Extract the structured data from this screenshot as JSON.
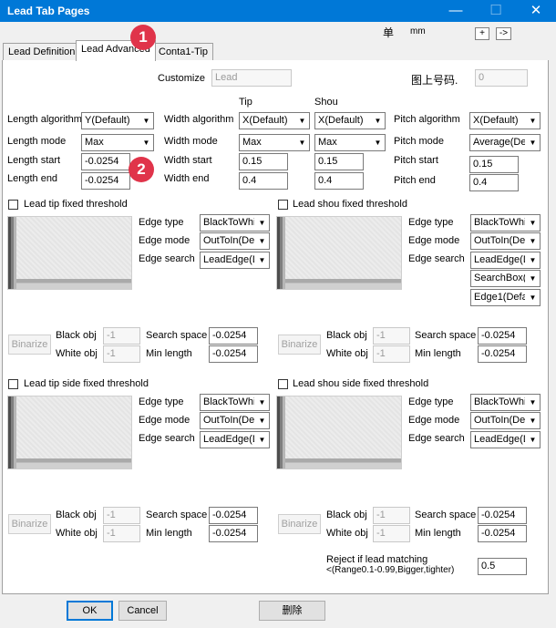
{
  "window": {
    "title": "Lead Tab Pages",
    "unit_label": "单",
    "unit_value": "mm",
    "plus_label": "+",
    "arrow_label": "->"
  },
  "tabs": [
    "Lead Definition",
    "Lead Advanced",
    "Conta1-Tip"
  ],
  "badges": [
    "1",
    "2"
  ],
  "customize": {
    "label": "Customize",
    "value": "Lead",
    "id_label": "图上号码.",
    "id_value": "0"
  },
  "columns": {
    "tip": "Tip",
    "shou": "Shou"
  },
  "algorithms": {
    "length_algorithm_label": "Length algorithm",
    "length_algorithm": "Y(Default)",
    "length_mode_label": "Length mode",
    "length_mode": "Max",
    "length_start_label": "Length start",
    "length_start": "-0.0254",
    "length_end_label": "Length end",
    "length_end": "-0.0254",
    "width_algorithm_label": "Width algorithm",
    "width_algorithm_tip": "X(Default)",
    "width_algorithm_shou": "X(Default)",
    "width_mode_label": "Width mode",
    "width_mode_tip": "Max",
    "width_mode_shou": "Max",
    "width_start_label": "Width start",
    "width_start_tip": "0.15",
    "width_start_shou": "0.15",
    "width_end_label": "Width end",
    "width_end_tip": "0.4",
    "width_end_shou": "0.4",
    "pitch_algorithm_label": "Pitch algorithm",
    "pitch_algorithm": "X(Default)",
    "pitch_mode_label": "Pitch mode",
    "pitch_mode": "Average(Def",
    "pitch_start_label": "Pitch start",
    "pitch_start": "0.15",
    "pitch_end_label": "Pitch end",
    "pitch_end": "0.4"
  },
  "common": {
    "edge_type": "Edge type",
    "edge_mode": "Edge mode",
    "edge_search": "Edge search",
    "binarize": "Binarize",
    "black_obj": "Black obj",
    "white_obj": "White obj",
    "search_space": "Search space",
    "min_length": "Min length"
  },
  "sections": {
    "tip": {
      "title": "Lead tip fixed threshold",
      "edge_type": "BlackToWhi",
      "edge_mode": "OutToIn(Def",
      "edge_search": "LeadEdge(D",
      "black_obj": "-1",
      "white_obj": "-1",
      "search_space": "-0.0254",
      "min_length": "-0.0254"
    },
    "shou": {
      "title": "Lead shou fixed threshold",
      "edge_type": "BlackToWhi",
      "edge_mode": "OutToIn(Def",
      "edge_search": "LeadEdge(D",
      "search_box": "SearchBox(D",
      "edge1": "Edge1(Defa",
      "black_obj": "-1",
      "white_obj": "-1",
      "search_space": "-0.0254",
      "min_length": "-0.0254"
    },
    "tip_side": {
      "title": "Lead tip side fixed threshold",
      "edge_type": "BlackToWhi",
      "edge_mode": "OutToIn(Def",
      "edge_search": "LeadEdge(D",
      "black_obj": "-1",
      "white_obj": "-1",
      "search_space": "-0.0254",
      "min_length": "-0.0254"
    },
    "shou_side": {
      "title": "Lead shou side fixed threshold",
      "edge_type": "BlackToWhi",
      "edge_mode": "OutToIn(Def",
      "edge_search": "LeadEdge(D",
      "black_obj": "-1",
      "white_obj": "-1",
      "search_space": "-0.0254",
      "min_length": "-0.0254"
    }
  },
  "reject": {
    "line1": "Reject if lead matching",
    "line2": "<(Range0.1-0.99,Bigger,tighter)",
    "value": "0.5"
  },
  "footer": {
    "ok": "OK",
    "cancel": "Cancel",
    "delete": "删除"
  },
  "colors": {
    "titlebar": "#0078d7",
    "badge": "#e0344a",
    "default_button_border": "#0078d7"
  }
}
